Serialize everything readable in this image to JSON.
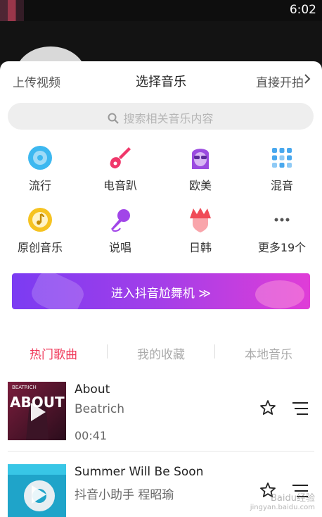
{
  "status_bar": {
    "time": "6:02"
  },
  "sheet": {
    "header": {
      "upload_label": "上传视频",
      "title": "选择音乐",
      "shoot_label": "直接开拍"
    },
    "search": {
      "placeholder": "搜索相关音乐内容"
    },
    "categories": [
      {
        "label": "流行",
        "icon": "vinyl-disc-icon",
        "color": "#3db8f0"
      },
      {
        "label": "电音趴",
        "icon": "electric-guitar-icon",
        "color": "#f0386b"
      },
      {
        "label": "欧美",
        "icon": "person-sunglasses-icon",
        "color": "#9b4be0"
      },
      {
        "label": "混音",
        "icon": "mixer-grid-icon",
        "color": "#49a8ee"
      },
      {
        "label": "原创音乐",
        "icon": "music-note-circle-icon",
        "color": "#f6c321"
      },
      {
        "label": "说唱",
        "icon": "microphone-icon",
        "color": "#a145e8"
      },
      {
        "label": "日韩",
        "icon": "spiky-hair-icon",
        "color": "#f04b57"
      },
      {
        "label": "更多19个",
        "icon": "more-dots-icon",
        "color": "#666666"
      }
    ],
    "banner": {
      "text": "进入抖音尬舞机 ≫"
    },
    "tabs": [
      {
        "label": "热门歌曲",
        "active": true
      },
      {
        "label": "我的收藏",
        "active": false
      },
      {
        "label": "本地音乐",
        "active": false
      }
    ],
    "songs": [
      {
        "title": "About",
        "artist": "Beatrich",
        "duration": "00:41",
        "cover_text": "ABOUT",
        "cover_subtext": "BEATRICH"
      },
      {
        "title": "Summer Will Be Soon",
        "artist": "抖音小助手 程昭瑜",
        "duration": ""
      }
    ]
  },
  "watermark": {
    "line1": "Baidu经验",
    "line2": "jingyan.baidu.com"
  },
  "colors": {
    "accent": "#f0385a",
    "banner_start": "#7b3cf2",
    "banner_end": "#e03dd7"
  }
}
